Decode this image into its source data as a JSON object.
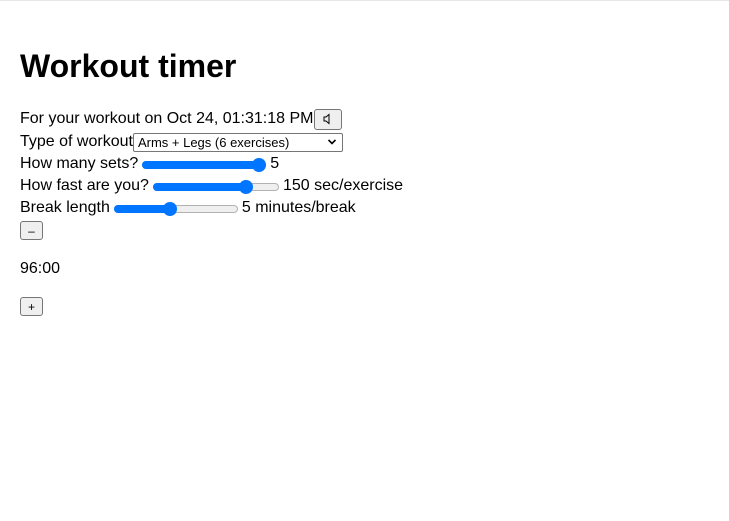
{
  "title": "Workout timer",
  "workout_line": {
    "label": "For your workout on Oct 24, 01:31:18 PM",
    "sound_icon": "speaker-icon"
  },
  "workout_type": {
    "label": "Type of workout",
    "selected": "Arms + Legs (6 exercises)"
  },
  "sets": {
    "label": "How many sets?",
    "value_text": "5",
    "fraction": 1.0
  },
  "speed": {
    "label": "How fast are you?",
    "value_text": "150 sec/exercise",
    "fraction": 0.77
  },
  "break_length": {
    "label": "Break length",
    "value_text": "5 minutes/break",
    "fraction": 0.45
  },
  "controls": {
    "minus_label": "–",
    "plus_label": "+"
  },
  "timer": {
    "value": "96:00"
  },
  "colors": {
    "accent": "#0075ff"
  }
}
